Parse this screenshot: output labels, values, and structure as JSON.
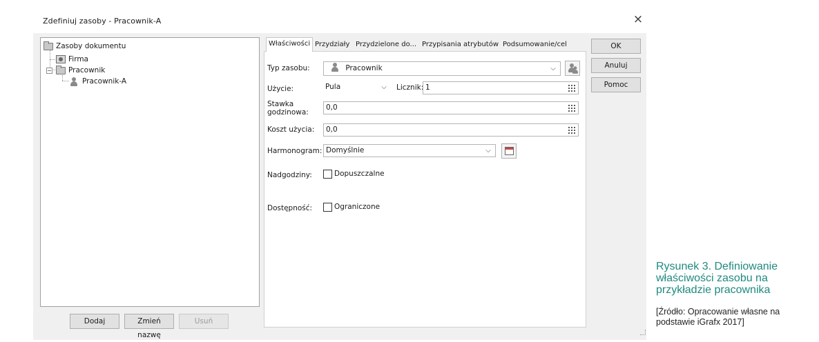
{
  "dialog": {
    "title": "Zdefiniuj zasoby - Pracownik-A",
    "close_glyph": "×"
  },
  "tree": {
    "root": "Zasoby dokumentu",
    "items": [
      {
        "label": "Firma",
        "icon": "group-icon"
      },
      {
        "label": "Pracownik",
        "icon": "folder-icon"
      },
      {
        "label": "Pracownik-A",
        "icon": "person-icon"
      }
    ],
    "expander": "−"
  },
  "tree_buttons": {
    "add": "Dodaj",
    "rename": "Zmień nazwę",
    "delete": "Usuń"
  },
  "tabs": [
    {
      "label": "Właściwości",
      "active": true
    },
    {
      "label": "Przydziały"
    },
    {
      "label": "Przydzielone do..."
    },
    {
      "label": "Przypisania atrybutów"
    },
    {
      "label": "Podsumowanie/cel"
    }
  ],
  "form": {
    "resource_type_label": "Typ zasobu:",
    "resource_type_value": "Pracownik",
    "usage_label": "Użycie:",
    "usage_value": "Pula",
    "counter_label": "Licznik:",
    "counter_value": "1",
    "hourly_rate_label_1": "Stawka",
    "hourly_rate_label_2": "godzinowa:",
    "hourly_rate_value": "0,0",
    "usage_cost_label": "Koszt użycia:",
    "usage_cost_value": "0,0",
    "schedule_label": "Harmonogram:",
    "schedule_value": "Domyślnie",
    "overtime_label": "Nadgodziny:",
    "overtime_option": "Dopuszczalne",
    "overtime_checked": false,
    "availability_label": "Dostępność:",
    "availability_option": "Ograniczone",
    "availability_checked": false
  },
  "side_buttons": {
    "ok": "OK",
    "cancel": "Anuluj",
    "help": "Pomoc"
  },
  "caption": {
    "figure": "Rysunek 3.",
    "title": "Definiowanie właściwości zasobu na przykładzie pracownika",
    "source": "[Źródło: Opracowanie własne na podstawie iGrafx 2017]",
    "color": "#1f8a7e"
  }
}
